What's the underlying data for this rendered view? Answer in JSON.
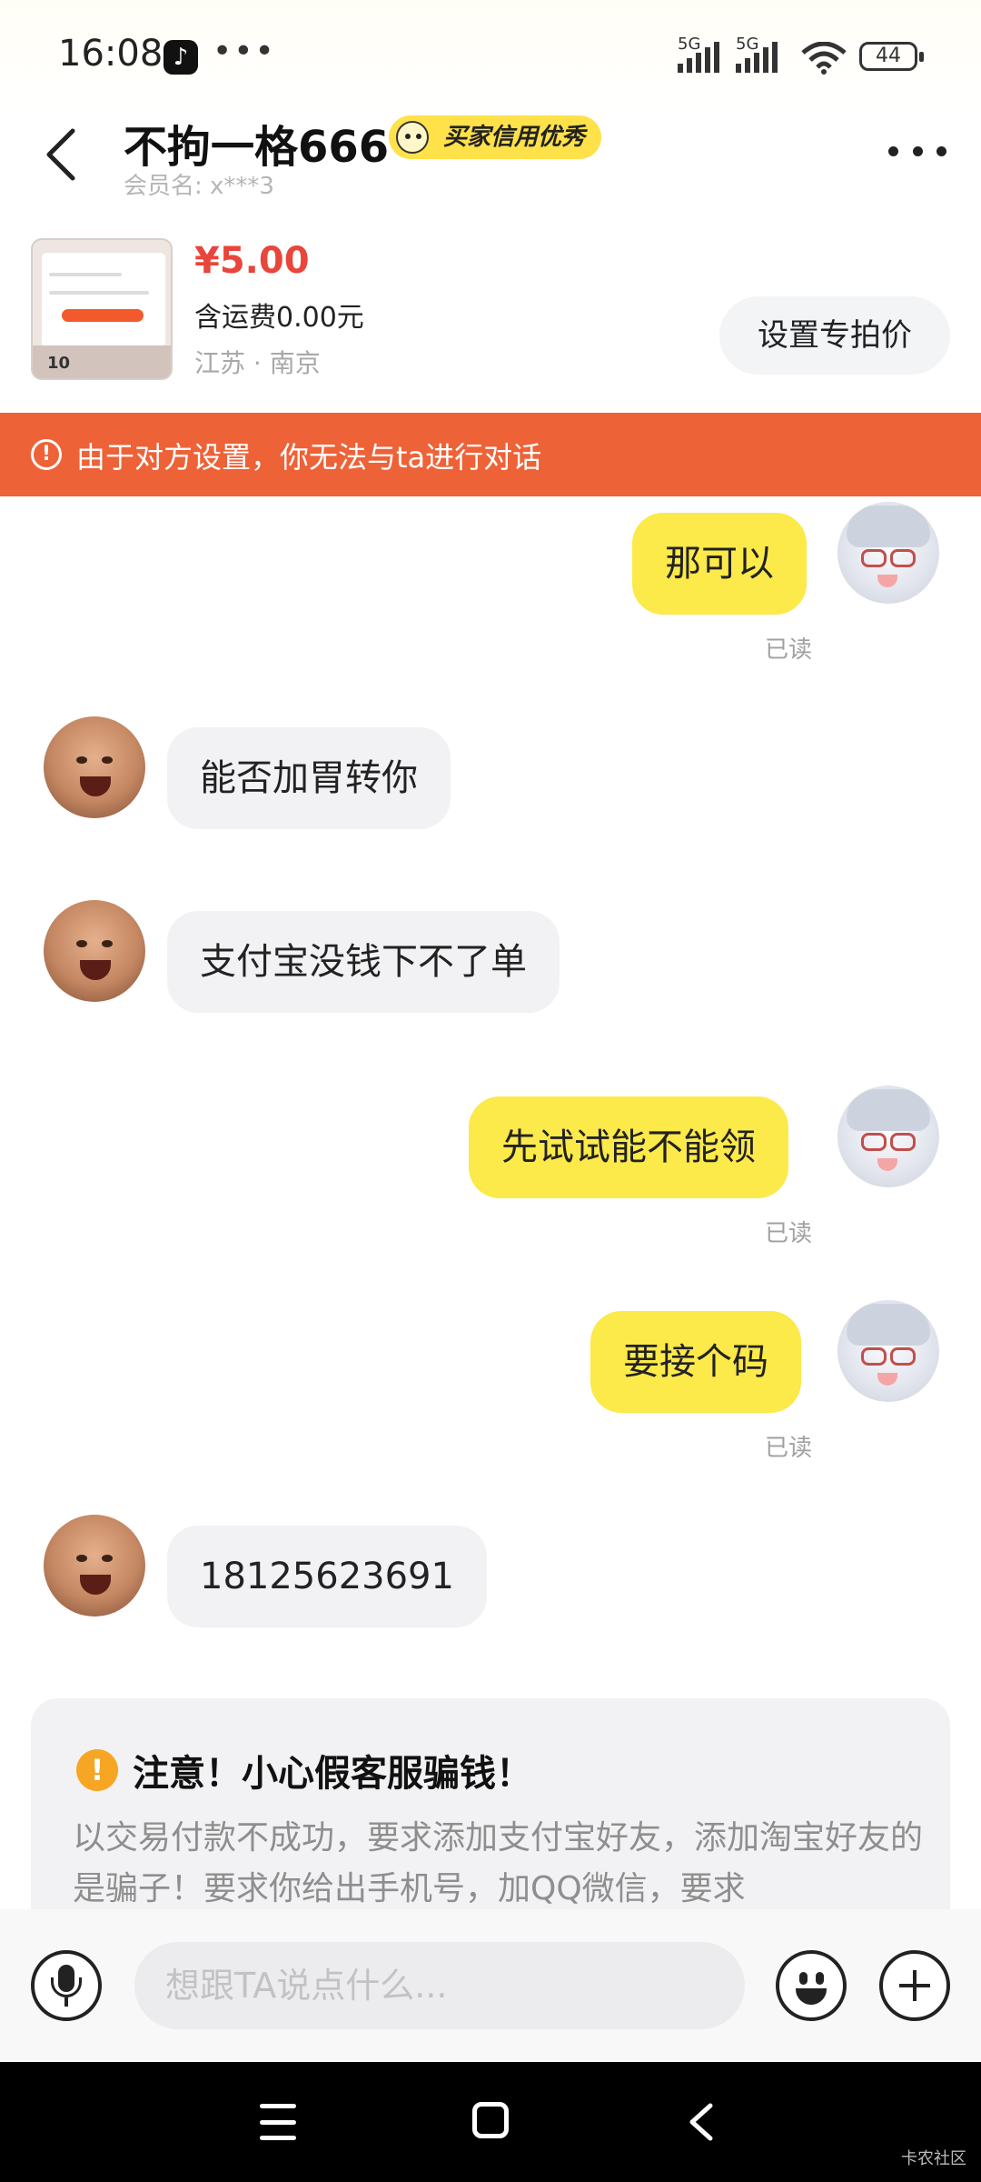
{
  "status_bar": {
    "time": "16:08",
    "battery": "44",
    "network1": "5G",
    "network2": "5G"
  },
  "header": {
    "title": "不拘一格666",
    "badge": "买家信用优秀",
    "member": "会员名: x***3"
  },
  "product": {
    "price": "¥5.00",
    "shipping": "含运费0.00元",
    "location": "江苏 · 南京",
    "special_price_button": "设置专拍价",
    "thumb_badge": "10"
  },
  "banner": {
    "text": "由于对方设置，你无法与ta进行对话"
  },
  "messages": [
    {
      "side": "me",
      "text": "那可以",
      "status": "已读"
    },
    {
      "side": "them",
      "text": "能否加胃转你"
    },
    {
      "side": "them",
      "text": "支付宝没钱下不了单"
    },
    {
      "side": "me",
      "text": "先试试能不能领",
      "status": "已读"
    },
    {
      "side": "me",
      "text": "要接个码",
      "status": "已读"
    },
    {
      "side": "them",
      "text": "18125623691"
    }
  ],
  "notice": {
    "title": "注意！小心假客服骗钱！",
    "body": "以交易付款不成功，要求添加支付宝好友，添加淘宝好友的是骗子！要求你给出手机号，加QQ微信，要求"
  },
  "input": {
    "placeholder": "想跟TA说点什么..."
  },
  "watermark": "卡农社区"
}
